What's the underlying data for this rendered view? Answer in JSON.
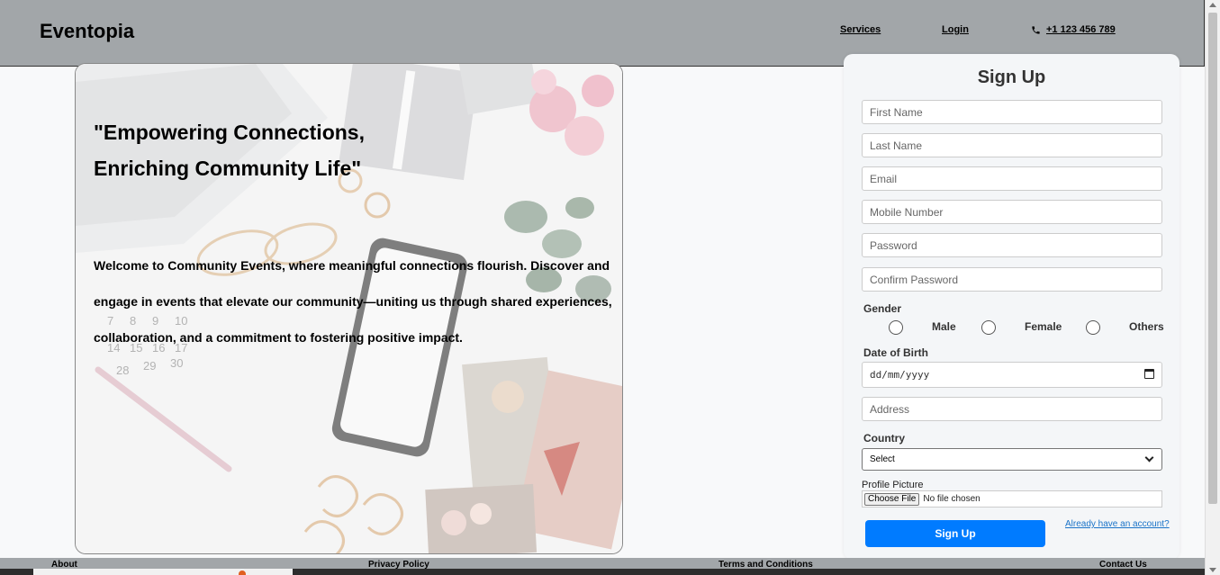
{
  "header": {
    "brand": "Eventopia",
    "nav": {
      "services": "Services",
      "login": "Login",
      "phone": "+1 123 456 789"
    }
  },
  "hero": {
    "title_line1": "\"Empowering Connections,",
    "title_line2": "Enriching Community Life\"",
    "text": "Welcome to Community Events, where meaningful connections flourish. Discover and engage in events that elevate our community—uniting us through shared experiences, collaboration, and a commitment to fostering positive impact."
  },
  "signup": {
    "title": "Sign Up",
    "placeholders": {
      "first_name": "First Name",
      "last_name": "Last Name",
      "email": "Email",
      "mobile": "Mobile Number",
      "password": "Password",
      "confirm_password": "Confirm Password",
      "address": "Address"
    },
    "gender_label": "Gender",
    "gender_options": [
      "Male",
      "Female",
      "Others"
    ],
    "dob_label": "Date of Birth",
    "dob_value": "dd/mm/yyyy",
    "country_label": "Country",
    "country_value": "Select",
    "profile_label": "Profile Picture",
    "file_button": "Choose File",
    "file_status": "No file chosen",
    "submit": "Sign Up",
    "login_link": "Already have an account?"
  },
  "footer": {
    "about": "About",
    "privacy": "Privacy Policy",
    "terms": "Terms and Conditions",
    "contact": "Contact Us"
  },
  "colors": {
    "header_bg": "#a2a6a9",
    "primary": "#007bff",
    "link": "#1a73c8"
  }
}
